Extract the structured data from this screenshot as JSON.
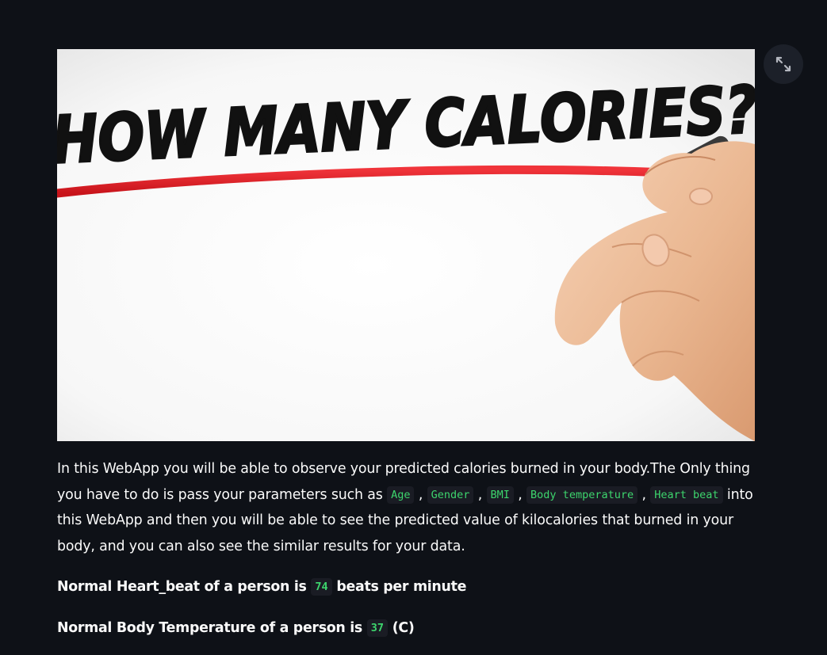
{
  "hero_image": {
    "headline": "HOW MANY CALORIES?",
    "colors": {
      "headline": "#111111",
      "marker_line": "#e31b23",
      "skin": "#f2c3a1",
      "background": "#ffffff"
    }
  },
  "expand_button": {
    "icon": "expand-icon"
  },
  "intro": {
    "text_before": "In this WebApp you will be able to observe your predicted calories burned in your body.The Only thing you have to do is pass your parameters such as ",
    "params": [
      "Age",
      "Gender",
      "BMI",
      "Body temperature",
      "Heart beat"
    ],
    "separator": " , ",
    "text_after": " into this WebApp and then you will be able to see the predicted value of kilocalories that burned in your body, and you can also see the similar results for your data."
  },
  "heart_beat": {
    "prefix": "Normal Heart_beat of a person is ",
    "value": "74",
    "suffix": " beats per minute"
  },
  "body_temp": {
    "prefix": "Normal Body Temperature of a person is ",
    "value": "37",
    "suffix": " (C)"
  },
  "theme": {
    "background": "#0e1117",
    "text": "#fafafa",
    "code_text": "#3dd56d",
    "code_bg": "#1a1c24"
  }
}
